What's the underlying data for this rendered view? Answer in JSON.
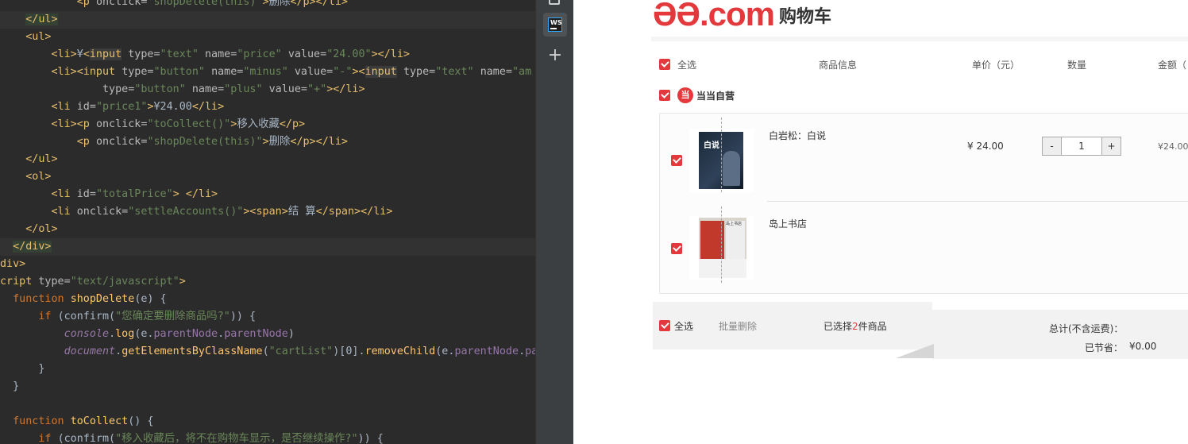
{
  "editor": {
    "lines": [
      [
        [
          "tok-txt",
          "            "
        ],
        [
          "tok-tag",
          "<p "
        ],
        [
          "tok-attr",
          "onclick="
        ],
        [
          "tok-str",
          "\"shopDelete(this)\""
        ],
        [
          "tok-tag",
          ">"
        ],
        [
          "tok-txt",
          "删除"
        ],
        [
          "tok-tag",
          "</p></li>"
        ]
      ],
      [
        [
          "tok-txt",
          "    "
        ],
        [
          "tok-tag tok-hl2",
          "</ul>"
        ]
      ],
      [
        [
          "tok-txt",
          "    "
        ],
        [
          "tok-tag",
          "<ul>"
        ]
      ],
      [
        [
          "tok-txt",
          "        "
        ],
        [
          "tok-tag",
          "<li>"
        ],
        [
          "tok-txt",
          "¥"
        ],
        [
          "tok-tag",
          "<"
        ],
        [
          "tok-hl",
          "input"
        ],
        [
          "tok-txt",
          " "
        ],
        [
          "tok-attr",
          "type="
        ],
        [
          "tok-str",
          "\"text\""
        ],
        [
          "tok-txt",
          " "
        ],
        [
          "tok-attr",
          "name="
        ],
        [
          "tok-str",
          "\"price\""
        ],
        [
          "tok-txt",
          " "
        ],
        [
          "tok-attr",
          "value="
        ],
        [
          "tok-str",
          "\"24.00\""
        ],
        [
          "tok-tag",
          "></li>"
        ]
      ],
      [
        [
          "tok-txt",
          "        "
        ],
        [
          "tok-tag",
          "<li><input "
        ],
        [
          "tok-attr",
          "type="
        ],
        [
          "tok-str",
          "\"button\""
        ],
        [
          "tok-txt",
          " "
        ],
        [
          "tok-attr",
          "name="
        ],
        [
          "tok-str",
          "\"minus\""
        ],
        [
          "tok-txt",
          " "
        ],
        [
          "tok-attr",
          "value="
        ],
        [
          "tok-str",
          "\"-\""
        ],
        [
          "tok-tag",
          "><"
        ],
        [
          "tok-hl",
          "input"
        ],
        [
          "tok-txt",
          " "
        ],
        [
          "tok-attr",
          "type="
        ],
        [
          "tok-str",
          "\"text\""
        ],
        [
          "tok-txt",
          " "
        ],
        [
          "tok-attr",
          "name="
        ],
        [
          "tok-str",
          "\"am"
        ]
      ],
      [
        [
          "tok-txt",
          "                "
        ],
        [
          "tok-attr",
          "type="
        ],
        [
          "tok-str",
          "\"button\""
        ],
        [
          "tok-txt",
          " "
        ],
        [
          "tok-attr",
          "name="
        ],
        [
          "tok-str",
          "\"plus\""
        ],
        [
          "tok-txt",
          " "
        ],
        [
          "tok-attr",
          "value="
        ],
        [
          "tok-str",
          "\"+\""
        ],
        [
          "tok-tag",
          "></li>"
        ]
      ],
      [
        [
          "tok-txt",
          "        "
        ],
        [
          "tok-tag",
          "<li "
        ],
        [
          "tok-attr",
          "id="
        ],
        [
          "tok-str",
          "\"price1\""
        ],
        [
          "tok-tag",
          ">"
        ],
        [
          "tok-txt",
          "¥24.00"
        ],
        [
          "tok-tag",
          "</li>"
        ]
      ],
      [
        [
          "tok-txt",
          "        "
        ],
        [
          "tok-tag",
          "<li><p "
        ],
        [
          "tok-attr",
          "onclick="
        ],
        [
          "tok-str",
          "\"toCollect()\""
        ],
        [
          "tok-tag",
          ">"
        ],
        [
          "tok-txt",
          "移入收藏"
        ],
        [
          "tok-tag",
          "</p>"
        ]
      ],
      [
        [
          "tok-txt",
          "            "
        ],
        [
          "tok-tag",
          "<p "
        ],
        [
          "tok-attr",
          "onclick="
        ],
        [
          "tok-str",
          "\"shopDelete(this)\""
        ],
        [
          "tok-tag",
          ">"
        ],
        [
          "tok-txt",
          "删除"
        ],
        [
          "tok-tag",
          "</p></li>"
        ]
      ],
      [
        [
          "tok-txt",
          "    "
        ],
        [
          "tok-tag",
          "</ul>"
        ]
      ],
      [
        [
          "tok-txt",
          "    "
        ],
        [
          "tok-tag",
          "<ol>"
        ]
      ],
      [
        [
          "tok-txt",
          "        "
        ],
        [
          "tok-tag",
          "<li "
        ],
        [
          "tok-attr",
          "id="
        ],
        [
          "tok-str",
          "\"totalPrice\""
        ],
        [
          "tok-tag",
          ">"
        ],
        [
          "tok-txt",
          " "
        ],
        [
          "tok-tag",
          "</li>"
        ]
      ],
      [
        [
          "tok-txt",
          "        "
        ],
        [
          "tok-tag",
          "<li "
        ],
        [
          "tok-attr",
          "onclick="
        ],
        [
          "tok-str",
          "\"settleAccounts()\""
        ],
        [
          "tok-tag",
          "><span>"
        ],
        [
          "tok-txt",
          "结 算"
        ],
        [
          "tok-tag",
          "</span></li>"
        ]
      ],
      [
        [
          "tok-txt",
          "    "
        ],
        [
          "tok-tag",
          "</ol>"
        ]
      ],
      [
        [
          "tok-txt",
          "  "
        ],
        [
          "tok-tag tok-hl2",
          "</div>"
        ]
      ],
      [
        [
          "tok-tag",
          "div>"
        ]
      ],
      [
        [
          "tok-tag",
          "cript "
        ],
        [
          "tok-attr",
          "type="
        ],
        [
          "tok-str",
          "\"text/javascript\""
        ],
        [
          "tok-tag",
          ">"
        ]
      ],
      [
        [
          "tok-txt",
          "  "
        ],
        [
          "tok-kw",
          "function "
        ],
        [
          "tok-fn",
          "shopDelete"
        ],
        [
          "tok-txt",
          "(e) {"
        ]
      ],
      [
        [
          "tok-txt",
          "      "
        ],
        [
          "tok-kw",
          "if "
        ],
        [
          "tok-txt",
          "(confirm("
        ],
        [
          "tok-str",
          "\"您确定要删除商品吗?\""
        ],
        [
          "tok-txt",
          ")) {"
        ]
      ],
      [
        [
          "tok-txt",
          "          "
        ],
        [
          "tok-glob",
          "console"
        ],
        [
          "tok-txt",
          "."
        ],
        [
          "tok-fn",
          "log"
        ],
        [
          "tok-txt",
          "(e."
        ],
        [
          "tok-prop",
          "parentNode"
        ],
        [
          "tok-txt",
          "."
        ],
        [
          "tok-prop",
          "parentNode"
        ],
        [
          "tok-txt",
          ")"
        ]
      ],
      [
        [
          "tok-txt",
          "          "
        ],
        [
          "tok-glob",
          "document"
        ],
        [
          "tok-txt",
          "."
        ],
        [
          "tok-fn",
          "getElementsByClassName"
        ],
        [
          "tok-txt",
          "("
        ],
        [
          "tok-str",
          "\"cartList\""
        ],
        [
          "tok-txt",
          ")[0]."
        ],
        [
          "tok-fn",
          "removeChild"
        ],
        [
          "tok-txt",
          "(e."
        ],
        [
          "tok-prop",
          "parentNode"
        ],
        [
          "tok-txt",
          "."
        ],
        [
          "tok-prop",
          "par"
        ]
      ],
      [
        [
          "tok-txt",
          "      }"
        ]
      ],
      [
        [
          "tok-txt",
          "  }"
        ]
      ],
      [
        [
          "tok-txt",
          ""
        ]
      ],
      [
        [
          "tok-txt",
          "  "
        ],
        [
          "tok-kw",
          "function "
        ],
        [
          "tok-fn",
          "toCollect"
        ],
        [
          "tok-txt",
          "() {"
        ]
      ],
      [
        [
          "tok-txt",
          "      "
        ],
        [
          "tok-kw",
          "if "
        ],
        [
          "tok-txt",
          "(confirm("
        ],
        [
          "tok-str",
          "\"移入收藏后，将不在购物车显示，是否继续操作?\""
        ],
        [
          "tok-txt",
          ")) {"
        ]
      ]
    ]
  },
  "toolstrip": {
    "ws_label": "WS",
    "plus_label": "+"
  },
  "cart": {
    "logo_mark": "ƏƏ.com",
    "logo_text": "购物车",
    "header": {
      "select_all": "全选",
      "product_info": "商品信息",
      "unit_price": "单价（元）",
      "quantity": "数量",
      "amount": "金额（"
    },
    "shop": {
      "icon": "当",
      "name": "当当自营"
    },
    "items": [
      {
        "title": "白岩松：白说",
        "cover_text": "白说",
        "price": "¥  24.00",
        "qty": "1",
        "minus": "-",
        "plus": "+",
        "amount": "¥24.00"
      },
      {
        "title": "岛上书店",
        "cover_text": "岛上书店"
      }
    ],
    "footer": {
      "select_all": "全选",
      "batch_delete": "批量删除",
      "selected_prefix": "已选择",
      "selected_count": "2",
      "selected_suffix": "件商品",
      "total_label": "总计(不含运费)：",
      "saved_label": "已节省：",
      "saved_value": "¥0.00"
    }
  }
}
